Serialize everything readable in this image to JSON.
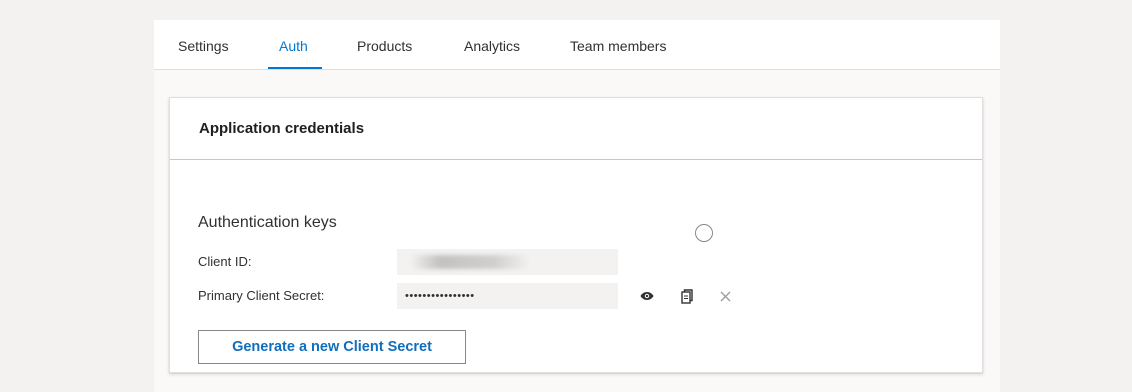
{
  "tabs": [
    {
      "label": "Settings",
      "active": false
    },
    {
      "label": "Auth",
      "active": true
    },
    {
      "label": "Products",
      "active": false
    },
    {
      "label": "Analytics",
      "active": false
    },
    {
      "label": "Team members",
      "active": false
    }
  ],
  "card": {
    "title": "Application credentials",
    "section_title": "Authentication keys",
    "client_id": {
      "label": "Client ID:",
      "value": ""
    },
    "primary_secret": {
      "label": "Primary Client Secret:",
      "masked_value": "••••••••••••••••",
      "actions": [
        "eye-icon",
        "copy-icon",
        "close-icon"
      ]
    },
    "generate_button_label": "Generate a new Client Secret"
  },
  "colors": {
    "accent": "#0078d4",
    "background": "#f3f2f1",
    "card": "#ffffff"
  }
}
